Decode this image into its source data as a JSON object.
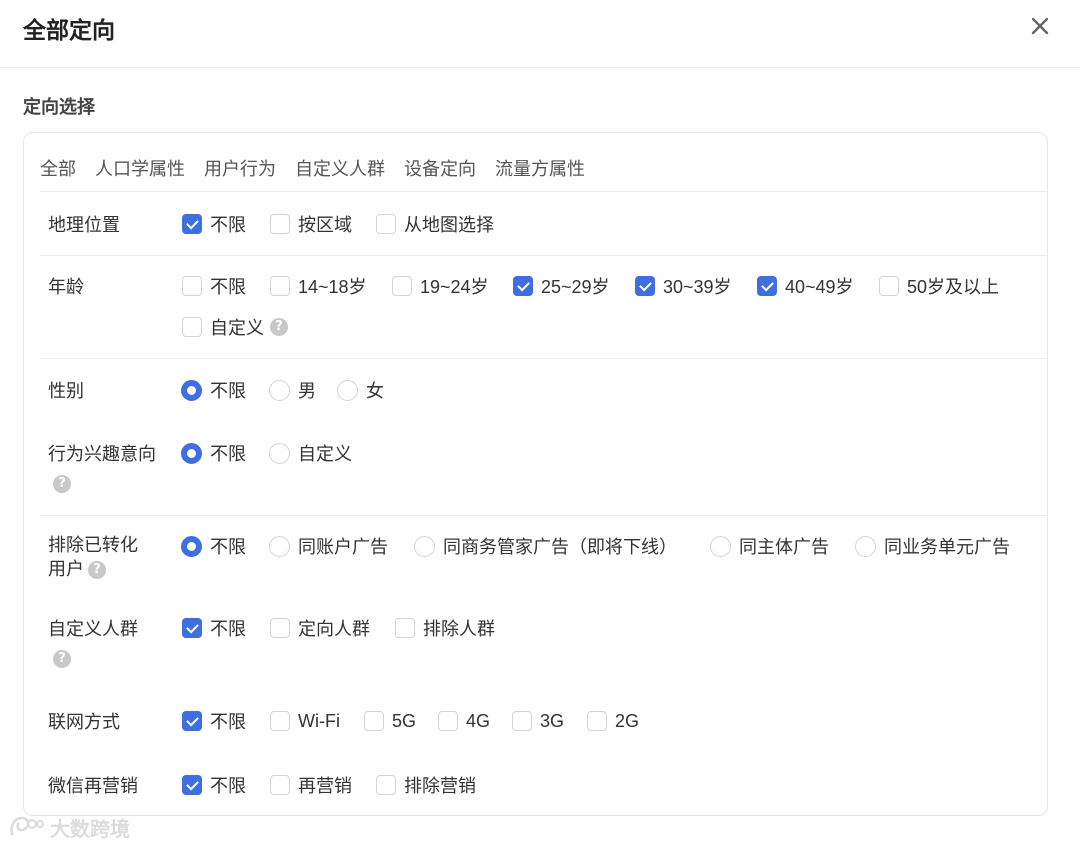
{
  "dialog": {
    "title": "全部定向",
    "close_label": "✕"
  },
  "section_title": "定向选择",
  "tabs": [
    "全部",
    "人口学属性",
    "用户行为",
    "自定义人群",
    "设备定向",
    "流量方属性"
  ],
  "rows": {
    "location": {
      "label": "地理位置",
      "options": [
        {
          "label": "不限",
          "checked": true
        },
        {
          "label": "按区域",
          "checked": false
        },
        {
          "label": "从地图选择",
          "checked": false
        }
      ]
    },
    "age": {
      "label": "年龄",
      "options": [
        {
          "label": "不限",
          "checked": false
        },
        {
          "label": "14~18岁",
          "checked": false
        },
        {
          "label": "19~24岁",
          "checked": false
        },
        {
          "label": "25~29岁",
          "checked": true
        },
        {
          "label": "30~39岁",
          "checked": true
        },
        {
          "label": "40~49岁",
          "checked": true
        },
        {
          "label": "50岁及以上",
          "checked": false
        },
        {
          "label": "自定义",
          "checked": false
        }
      ]
    },
    "gender": {
      "label": "性别",
      "options": [
        {
          "label": "不限",
          "selected": true
        },
        {
          "label": "男",
          "selected": false
        },
        {
          "label": "女",
          "selected": false
        }
      ]
    },
    "interest": {
      "label": "行为兴趣意向",
      "options": [
        {
          "label": "不限",
          "selected": true
        },
        {
          "label": "自定义",
          "selected": false
        }
      ]
    },
    "exclude": {
      "label_line1": "排除已转化",
      "label_line2": "用户",
      "options": [
        {
          "label": "不限",
          "selected": true
        },
        {
          "label": "同账户广告",
          "selected": false
        },
        {
          "label": "同商务管家广告（即将下线）",
          "selected": false
        },
        {
          "label": "同主体广告",
          "selected": false
        },
        {
          "label": "同业务单元广告",
          "selected": false
        }
      ]
    },
    "custom_audience": {
      "label": "自定义人群",
      "options": [
        {
          "label": "不限",
          "checked": true
        },
        {
          "label": "定向人群",
          "checked": false
        },
        {
          "label": "排除人群",
          "checked": false
        }
      ]
    },
    "network": {
      "label": "联网方式",
      "options": [
        {
          "label": "不限",
          "checked": true
        },
        {
          "label": "Wi-Fi",
          "checked": false
        },
        {
          "label": "5G",
          "checked": false
        },
        {
          "label": "4G",
          "checked": false
        },
        {
          "label": "3G",
          "checked": false
        },
        {
          "label": "2G",
          "checked": false
        }
      ]
    },
    "wechat": {
      "label": "微信再营销",
      "options": [
        {
          "label": "不限",
          "checked": true
        },
        {
          "label": "再营销",
          "checked": false
        },
        {
          "label": "排除营销",
          "checked": false
        }
      ]
    }
  },
  "help_glyph": "?",
  "watermark": {
    "text": "大数跨境"
  },
  "colors": {
    "accent": "#3d6fe0",
    "border": "#d4d4d4",
    "divider": "#ececec"
  }
}
